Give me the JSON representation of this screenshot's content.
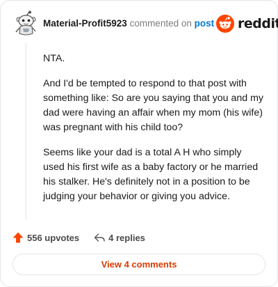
{
  "comment": {
    "author": "Material-Profit5923",
    "verb": "commented on",
    "target": "post",
    "paragraphs": [
      "NTA.",
      "And I'd be tempted to respond to that post with something like: So are you saying that you and my dad were having an affair when my mom (his wife) was pregnant with his child too?",
      "Seems like your dad is a total A H who simply used his first wife as a baby factory or he married his stalker. He's definitely not in a position to be judging your behavior or giving you advice."
    ],
    "upvotes": "556 upvotes",
    "replies": "4 replies",
    "view_comments": "View 4 comments"
  },
  "brand": {
    "name": "reddit"
  },
  "icons": {
    "avatar": "snoo-avatar-icon",
    "brand_logo": "reddit-alien-icon",
    "upvote": "upvote-arrow-icon",
    "reply": "reply-arrow-icon"
  },
  "colors": {
    "brand_orange": "#ff4500",
    "upvote_orange": "#ff4500",
    "link_blue": "#0079d3",
    "view_text": "#d93a00",
    "border": "#e3e5e8"
  }
}
